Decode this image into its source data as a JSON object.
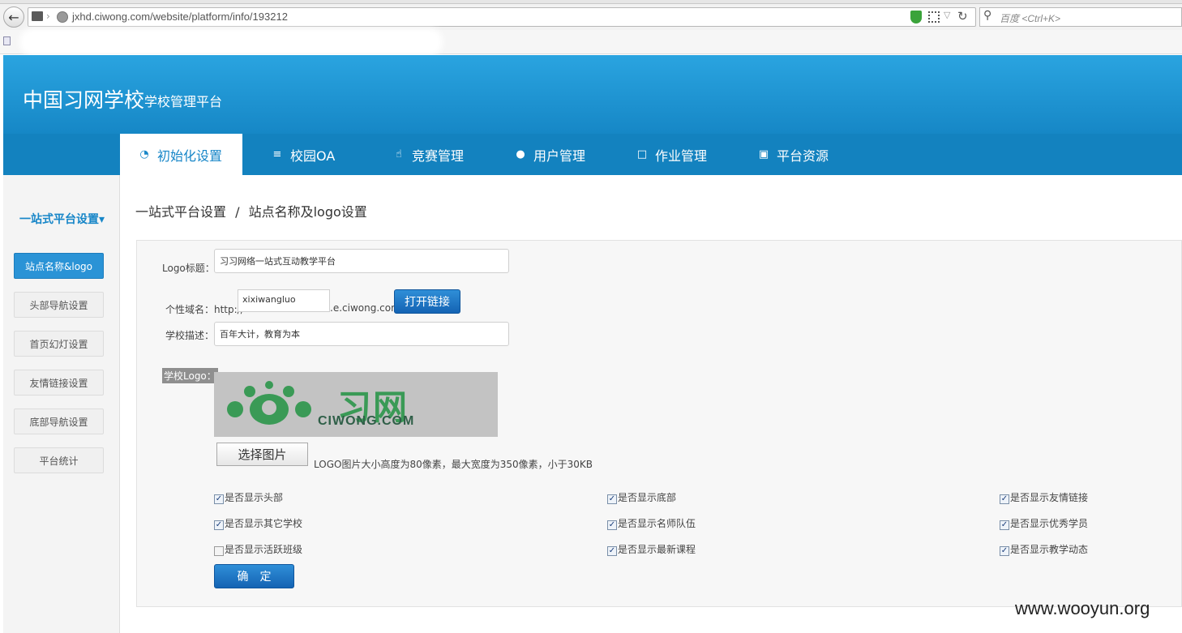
{
  "browser": {
    "url": "jxhd.ciwong.com/website/platform/info/193212",
    "search_placeholder": "百度 <Ctrl+K>"
  },
  "header": {
    "title": "中国习网学校",
    "subtitle": "学校管理平台"
  },
  "nav": {
    "items": [
      {
        "label": "初始化设置",
        "icon": "pie-chart-icon"
      },
      {
        "label": "校园OA",
        "icon": "list-icon"
      },
      {
        "label": "竞赛管理",
        "icon": "thumbs-up-icon"
      },
      {
        "label": "用户管理",
        "icon": "users-icon"
      },
      {
        "label": "作业管理",
        "icon": "inbox-icon"
      },
      {
        "label": "平台资源",
        "icon": "monitor-icon"
      }
    ]
  },
  "sidebar": {
    "heading": "一站式平台设置",
    "items": [
      "站点名称&logo",
      "头部导航设置",
      "首页幻灯设置",
      "友情链接设置",
      "底部导航设置",
      "平台统计"
    ]
  },
  "breadcrumb": {
    "parent": "一站式平台设置",
    "sep": "/",
    "current": "站点名称及logo设置"
  },
  "form": {
    "logo_title_label": "Logo标题：",
    "logo_title_value": "习习网络一站式互动教学平台",
    "domain_label": "个性域名：http://",
    "domain_value": "xixiwangluo",
    "domain_suffix": ".e.ciwong.com",
    "open_link_label": "打开链接",
    "desc_label": "学校描述：",
    "desc_value": "百年大计，教育为本",
    "school_logo_label": "学校Logo：",
    "logo_brand_cn": "习网",
    "logo_brand_en": "CIWONG.COM",
    "choose_image_label": "选择图片",
    "image_hint": "LOGO图片大小高度为80像素，最大宽度为350像素，小于30KB",
    "checkboxes": [
      {
        "label": "是否显示头部",
        "checked": true
      },
      {
        "label": "是否显示底部",
        "checked": true
      },
      {
        "label": "是否显示友情链接",
        "checked": true
      },
      {
        "label": "是否显示其它学校",
        "checked": true
      },
      {
        "label": "是否显示名师队伍",
        "checked": true
      },
      {
        "label": "是否显示优秀学员",
        "checked": true
      },
      {
        "label": "是否显示活跃班级",
        "checked": false
      },
      {
        "label": "是否显示最新课程",
        "checked": true
      },
      {
        "label": "是否显示教学动态",
        "checked": true
      }
    ],
    "submit_label": "确　定"
  },
  "watermark": "www.wooyun.org",
  "colors": {
    "header_blue": "#1c92d2",
    "nav_blue": "#1382bf",
    "accent": "#1786c8",
    "logo_green": "#3a9a56"
  }
}
